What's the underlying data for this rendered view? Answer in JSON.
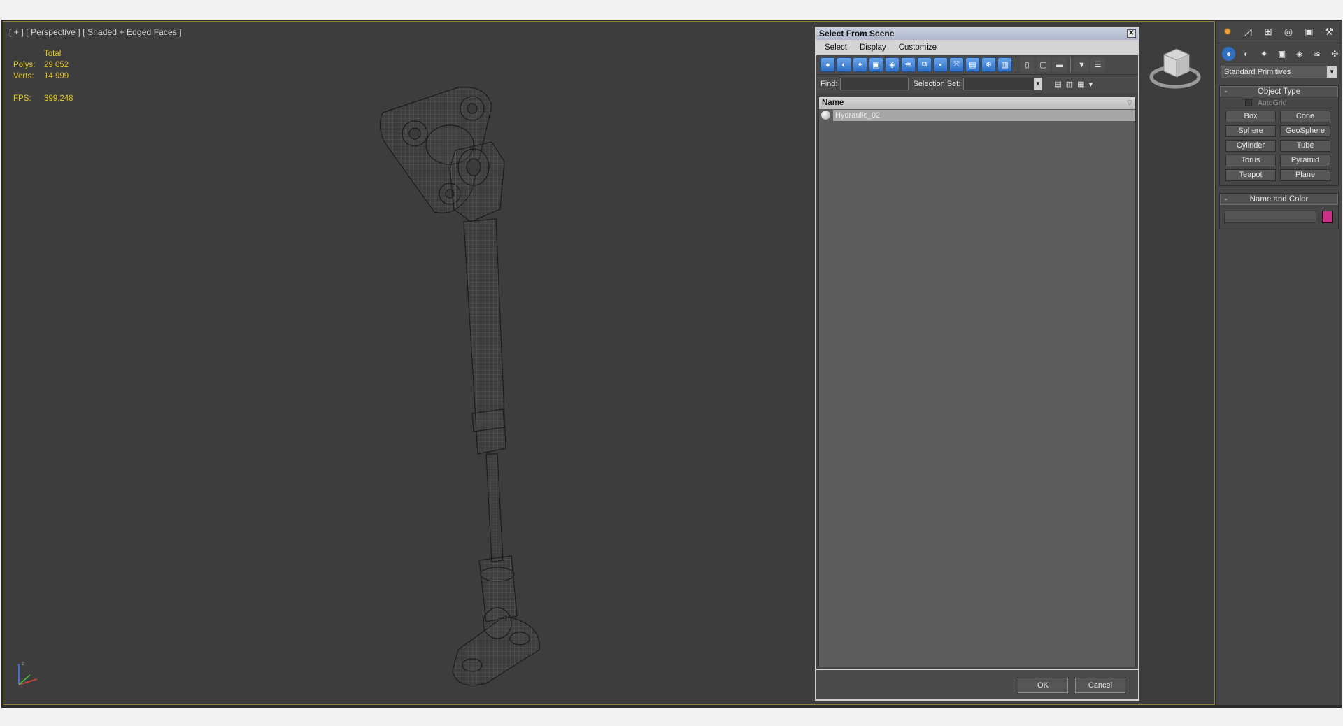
{
  "viewport": {
    "label": "[ + ] [ Perspective ] [ Shaded + Edged Faces ]",
    "stats": {
      "total_label": "Total",
      "polys_label": "Polys:",
      "polys_value": "29 052",
      "verts_label": "Verts:",
      "verts_value": "14 999",
      "fps_label": "FPS:",
      "fps_value": "399,248"
    }
  },
  "dialog": {
    "title": "Select From Scene",
    "close_label": "✕",
    "menu": [
      "Select",
      "Display",
      "Customize"
    ],
    "find_label": "Find:",
    "find_value": "",
    "selection_set_label": "Selection Set:",
    "list_header": "Name",
    "items": [
      {
        "name": "Hydraulic_02"
      }
    ],
    "ok_label": "OK",
    "cancel_label": "Cancel"
  },
  "command_panel": {
    "category": "Standard Primitives",
    "object_type_title": "Object Type",
    "autogrid_label": "AutoGrid",
    "primitives": [
      "Box",
      "Cone",
      "Sphere",
      "GeoSphere",
      "Cylinder",
      "Tube",
      "Torus",
      "Pyramid",
      "Teapot",
      "Plane"
    ],
    "name_color_title": "Name and Color",
    "object_name": "",
    "object_color": "#cc2f88"
  },
  "colors": {
    "stats_text": "#e3c51d",
    "viewport_bg": "#3d3d3d",
    "accent_blue": "#2f6fc4"
  }
}
